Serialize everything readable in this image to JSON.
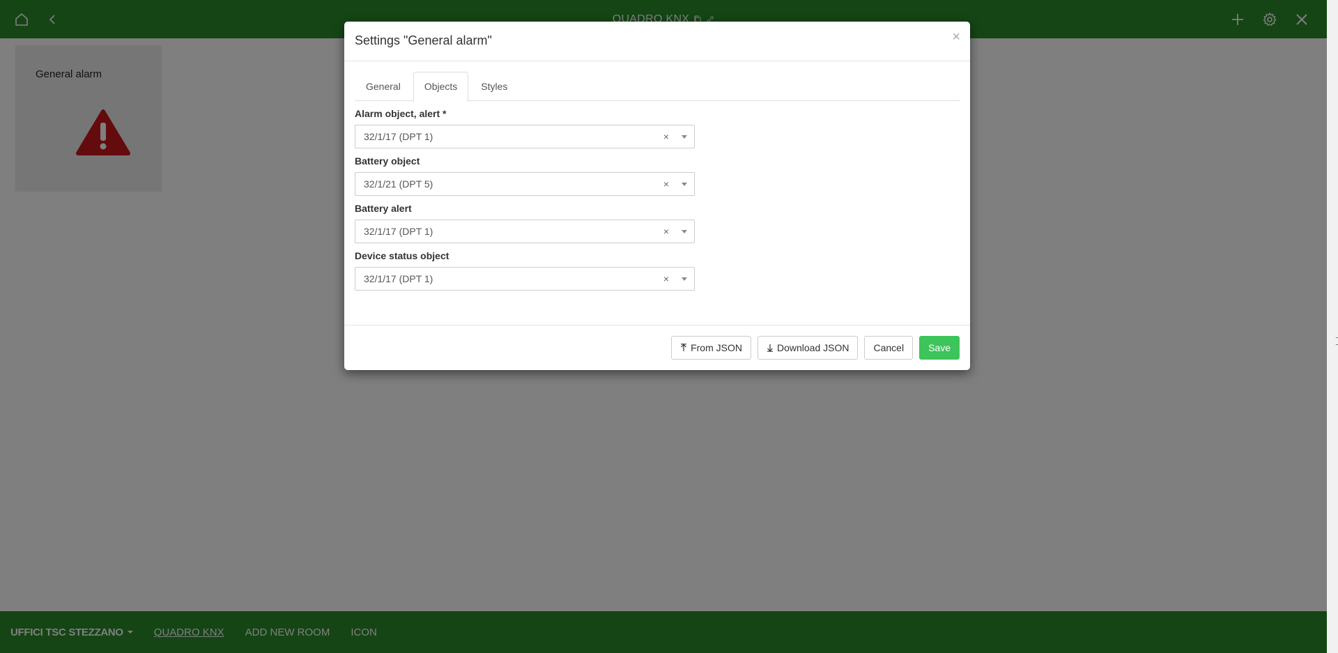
{
  "topbar": {
    "title": "QUADRO KNX",
    "home_icon": "home-icon",
    "back_icon": "chevron-left-icon",
    "copy_icon": "copy-icon",
    "link_icon": "link-icon",
    "add_icon": "plus-icon",
    "settings_icon": "gear-icon",
    "close_icon": "close-icon"
  },
  "card": {
    "title": "General alarm",
    "icon": "alarm-triangle-icon"
  },
  "bottombar": {
    "items": [
      {
        "label": "UFFICI TSC STEZZANO"
      },
      {
        "label": "QUADRO KNX"
      },
      {
        "label": "ADD NEW ROOM"
      },
      {
        "label": "ICON"
      }
    ]
  },
  "modal": {
    "title": "Settings \"General alarm\"",
    "close_label": "×",
    "tabs": [
      {
        "label": "General"
      },
      {
        "label": "Objects"
      },
      {
        "label": "Styles"
      }
    ],
    "active_tab": "Objects",
    "fields": [
      {
        "label": "Alarm object, alert *",
        "value": "32/1/17 (DPT 1)"
      },
      {
        "label": "Battery object",
        "value": "32/1/21 (DPT 5)"
      },
      {
        "label": "Battery alert",
        "value": "32/1/17 (DPT 1)"
      },
      {
        "label": "Device status object",
        "value": "32/1/17 (DPT 1)"
      }
    ],
    "clear_label": "×",
    "footer": {
      "from_json": "From JSON",
      "download_json": "Download JSON",
      "cancel": "Cancel",
      "save": "Save"
    }
  },
  "colors": {
    "bar_green": "#2a8a2a",
    "save_green": "#3dc45a",
    "alarm_red": "#c8161d"
  }
}
